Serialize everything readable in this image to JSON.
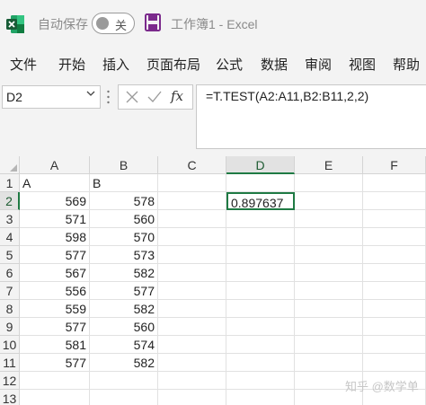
{
  "window": {
    "autosave_label": "自动保存",
    "autosave_state": "关",
    "title": "工作簿1  -  Excel",
    "accent": "#1f7a44"
  },
  "ribbon": {
    "tabs": [
      "文件",
      "开始",
      "插入",
      "页面布局",
      "公式",
      "数据",
      "审阅",
      "视图",
      "帮助"
    ]
  },
  "formula_bar": {
    "name_box": "D2",
    "cancel_icon": "close-icon",
    "enter_icon": "check-icon",
    "fx_label": "fx",
    "formula": "=T.TEST(A2:A11,B2:B11,2,2)"
  },
  "sheet": {
    "columns": [
      "A",
      "B",
      "C",
      "D",
      "E",
      "F"
    ],
    "rows": [
      "1",
      "2",
      "3",
      "4",
      "5",
      "6",
      "7",
      "8",
      "9",
      "10",
      "11",
      "12",
      "13"
    ],
    "selected_column": "D",
    "selected_row": "2",
    "cells": {
      "A1": "A",
      "B1": "B",
      "A2": "569",
      "B2": "578",
      "D2": "0.897637",
      "A3": "571",
      "B3": "560",
      "A4": "598",
      "B4": "570",
      "A5": "577",
      "B5": "573",
      "A6": "567",
      "B6": "582",
      "A7": "556",
      "B7": "577",
      "A8": "559",
      "B8": "582",
      "A9": "577",
      "B9": "560",
      "A10": "581",
      "B10": "574",
      "A11": "577",
      "B11": "582"
    }
  },
  "watermark": "知乎 @数学单"
}
